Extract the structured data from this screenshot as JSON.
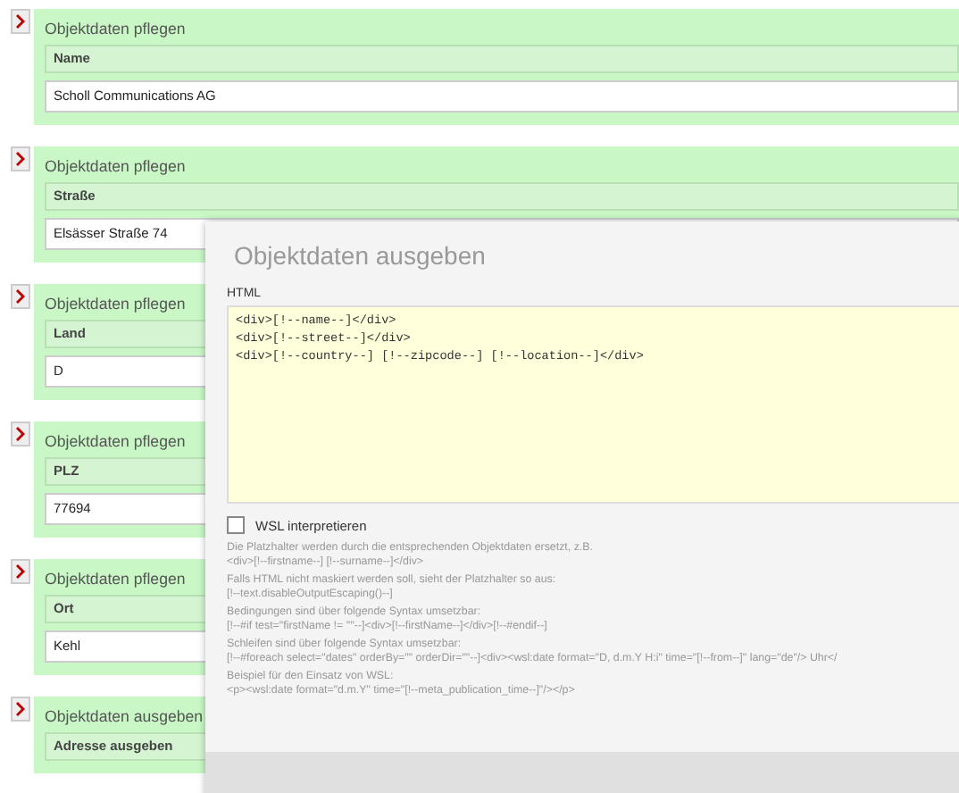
{
  "blocks": [
    {
      "kind": "input",
      "title": "Objektdaten pflegen",
      "label": "Name",
      "value": "Scholl Communications AG"
    },
    {
      "kind": "input",
      "title": "Objektdaten pflegen",
      "label": "Straße",
      "value": "Elsässer Straße 74"
    },
    {
      "kind": "input",
      "title": "Objektdaten pflegen",
      "label": "Land",
      "value": "D"
    },
    {
      "kind": "input",
      "title": "Objektdaten pflegen",
      "label": "PLZ",
      "value": "77694"
    },
    {
      "kind": "input",
      "title": "Objektdaten pflegen",
      "label": "Ort",
      "value": "Kehl"
    },
    {
      "kind": "output",
      "title": "Objektdaten ausgeben",
      "label": "Adresse ausgeben"
    }
  ],
  "dialog": {
    "title": "Objektdaten ausgeben",
    "field_label": "HTML",
    "code": [
      "<div>[!--name--]</div>",
      "<div>[!--street--]</div>",
      "<div>[!--country--] [!--zipcode--] [!--location--]</div>"
    ],
    "wsl_checkbox": {
      "label": "WSL interpretieren",
      "checked": false
    },
    "help": [
      "Die Platzhalter werden durch die entsprechenden Objektdaten ersetzt, z.B.",
      "<div>[!--firstname--] [!--surname--]</div>",
      "Falls HTML nicht maskiert werden soll, sieht der Platzhalter so aus:",
      "[!--text.disableOutputEscaping()--]",
      "Bedingungen sind über folgende Syntax umsetzbar:",
      "[!--#if test=\"firstName != ''\"--]<div>[!--firstName--]</div>[!--#endif--]",
      "Schleifen sind über folgende Syntax umsetzbar:",
      "[!--#foreach select=\"dates\" orderBy=\"\" orderDir=\"\"--]<div><wsl:date format=\"D, d.m.Y H:i\" time=\"[!--from--]\" lang=\"de\"/> Uhr</",
      "Beispiel für den Einsatz von WSL:",
      "<p><wsl:date format=\"d.m.Y\" time=\"[!--meta_publication_time--]\"/></p>"
    ]
  }
}
